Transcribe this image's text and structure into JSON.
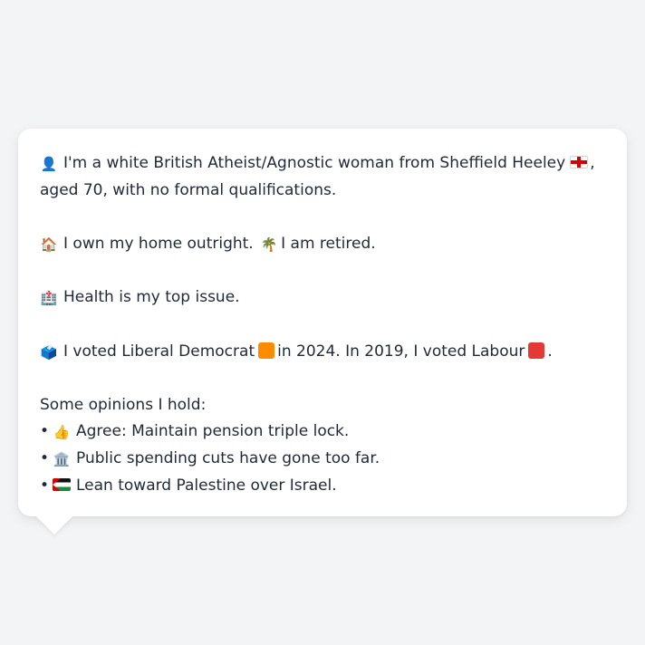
{
  "profile": {
    "intro_line1": "I'm a white British Atheist/Agnostic woman from Sheffield Heeley",
    "intro_comma": ",",
    "intro_line2": "aged 70, with no formal qualifications.",
    "home_text": "I own my home outright.",
    "work_text": "I am retired.",
    "issue_text": "Health is my top issue.",
    "vote_prefix": "I voted Liberal Democrat",
    "vote_mid": "in 2024. In 2019, I voted Labour",
    "vote_suffix": ".",
    "opinions_heading": "Some opinions I hold:",
    "opinions": [
      {
        "bullet": "•",
        "text": "Agree: Maintain pension triple lock."
      },
      {
        "bullet": "•",
        "text": "Public spending cuts have gone too far."
      },
      {
        "bullet": "•",
        "text": "Lean toward Palestine over Israel."
      }
    ]
  },
  "icons": {
    "person": "👤",
    "house": "🏠",
    "palm": "🌴",
    "hospital": "🏥",
    "ballot": "🗳️",
    "thumbs": "👍",
    "building": "🏛️"
  },
  "colors": {
    "lib_dem": "#fb8c00",
    "labour": "#e53935",
    "page_bg": "#f3f4f6",
    "card_bg": "#ffffff",
    "text": "#1f2937"
  }
}
